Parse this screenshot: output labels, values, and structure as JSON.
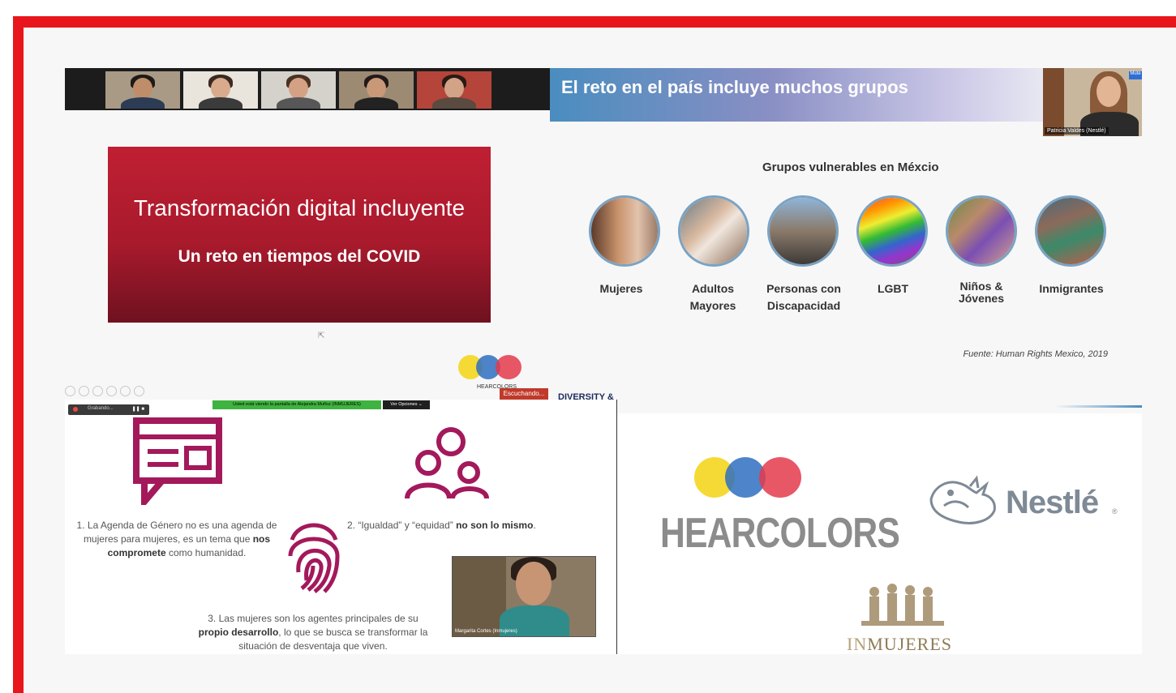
{
  "slide_top_right": {
    "title": "El reto en el país incluye muchos grupos",
    "speaker_label": "Patricia Valdes (Nestlé)",
    "corner_badge": "Mute",
    "groups_heading": "Grupos vulnerables en Méxcio",
    "groups": [
      {
        "label": "Mujeres"
      },
      {
        "label": "Adultos Mayores"
      },
      {
        "label": "Personas con Discapacidad"
      },
      {
        "label": "LGBT"
      },
      {
        "label": "Niños & Jóvenes"
      },
      {
        "label": "Inmigrantes"
      }
    ],
    "source": "Fuente: Human Rights Mexico, 2019"
  },
  "slide_top_left": {
    "title": "Transformación digital incluyente",
    "subtitle": "Un reto en tiempos del COVID"
  },
  "overlay": {
    "hearcolors_small": "HEARCOLORS",
    "listening": "Escuchando...",
    "diversity": "DIVERSITY &",
    "recording": "Grabando...",
    "recording_controls": "❚❚ ■",
    "viewing_banner": "Usted está viendo la pantalla de Alejandra Muñoz (INMUJERES)",
    "view_options": "Ver Opciones ⌄"
  },
  "shared_slide": {
    "point1_a": "1. La Agenda de Género no es  una agenda de mujeres para mujeres, es un tema que ",
    "point1_b": "nos compromete",
    "point1_c": " como humanidad.",
    "point2_a": "2. “Igualdad” y “equidad” ",
    "point2_b": "no son lo mismo",
    "point2_c": ".",
    "point3_a": "3. Las mujeres son los agentes principales de su ",
    "point3_b": "propio desarrollo",
    "point3_c": ", lo que se busca se transformar la situación de desventaja que viven.",
    "cam_label": "Margarita Cortes (Inmujeres)"
  },
  "logos": {
    "hearcolors": "HEARCOLORS",
    "nestle": "Nestlé",
    "nestle_reg": "®",
    "inmujeres_in": "IN",
    "inmujeres_rest": "MUJERES"
  },
  "colors": {
    "frame_red": "#e8161c",
    "slide_red": "#b01d30",
    "accent_magenta": "#a3195b",
    "hearcolors_yellow": "#f4d61f",
    "hearcolors_blue": "#2f6fc0",
    "hearcolors_red": "#e43a4b"
  }
}
